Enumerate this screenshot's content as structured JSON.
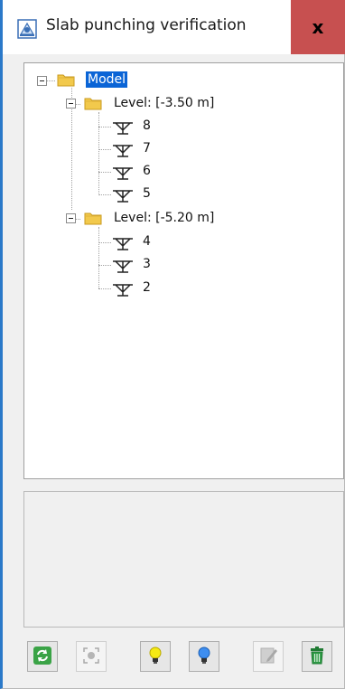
{
  "window": {
    "title": "Slab punching verification",
    "close_label": "x"
  },
  "tree": {
    "root": {
      "label": "Model",
      "selected": true
    },
    "levels": [
      {
        "label": "Level: [-3.50 m]",
        "items": [
          "8",
          "7",
          "6",
          "5"
        ]
      },
      {
        "label": "Level: [-5.20 m]",
        "items": [
          "4",
          "3",
          "2"
        ]
      }
    ]
  },
  "toolbar": {
    "buttons": [
      {
        "name": "refresh-button",
        "icon": "refresh-icon",
        "enabled": true
      },
      {
        "name": "focus-button",
        "icon": "target-icon",
        "enabled": false
      },
      {
        "name": "yellow-bulb-button",
        "icon": "yellow-lightbulb-icon",
        "enabled": true
      },
      {
        "name": "blue-bulb-button",
        "icon": "blue-lightbulb-icon",
        "enabled": true
      },
      {
        "name": "edit-button",
        "icon": "edit-icon",
        "enabled": false
      },
      {
        "name": "delete-button",
        "icon": "trash-icon",
        "enabled": true
      }
    ]
  },
  "colors": {
    "accent": "#2b79c9",
    "selection": "#0a64d6",
    "close": "#c75050",
    "folder": "#f2c94c"
  }
}
